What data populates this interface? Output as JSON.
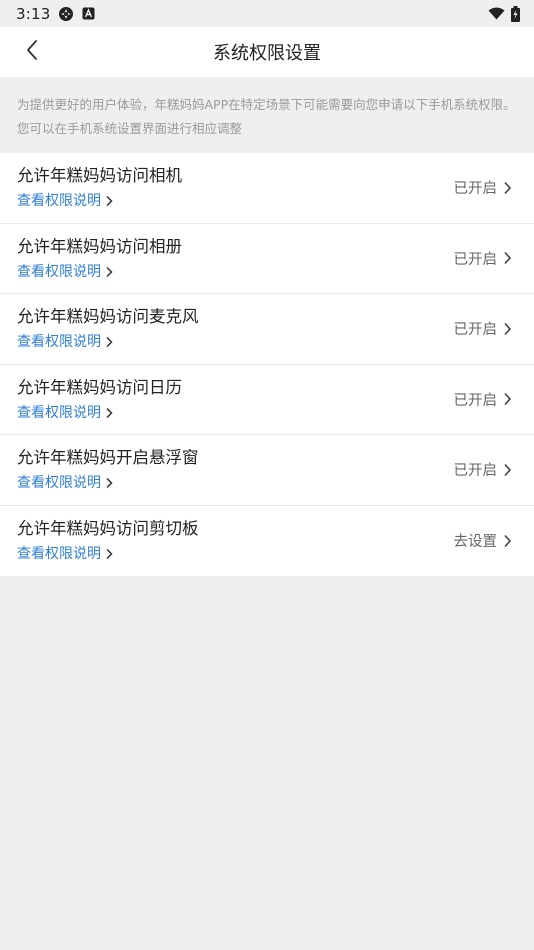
{
  "status_bar": {
    "time": "3:13",
    "icons": [
      "settings-icon",
      "accessibility-icon",
      "wifi-icon",
      "battery-charging-icon"
    ]
  },
  "header": {
    "title": "系统权限设置",
    "back_icon": "chevron-left-icon"
  },
  "notice": {
    "text": "为提供更好的用户体验，年糕妈妈APP在特定场景下可能需要向您申请以下手机系统权限。您可以在手机系统设置界面进行相应调整"
  },
  "permissions": [
    {
      "title": "允许年糕妈妈访问相机",
      "link": "查看权限说明",
      "status": "已开启"
    },
    {
      "title": "允许年糕妈妈访问相册",
      "link": "查看权限说明",
      "status": "已开启"
    },
    {
      "title": "允许年糕妈妈访问麦克风",
      "link": "查看权限说明",
      "status": "已开启"
    },
    {
      "title": "允许年糕妈妈访问日历",
      "link": "查看权限说明",
      "status": "已开启"
    },
    {
      "title": "允许年糕妈妈开启悬浮窗",
      "link": "查看权限说明",
      "status": "已开启"
    },
    {
      "title": "允许年糕妈妈访问剪切板",
      "link": "查看权限说明",
      "status": "去设置"
    }
  ],
  "colors": {
    "background": "#efefef",
    "link": "#2f7fd6",
    "notice_text": "#9a9a9a",
    "status_text": "#666666"
  }
}
